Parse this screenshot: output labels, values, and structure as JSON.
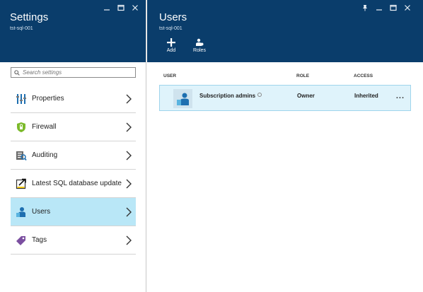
{
  "settings_blade": {
    "title": "Settings",
    "subtitle": "tst-sql-001",
    "search_placeholder": "Search settings",
    "items": [
      {
        "label": "Properties",
        "icon": "properties-icon"
      },
      {
        "label": "Firewall",
        "icon": "shield-icon"
      },
      {
        "label": "Auditing",
        "icon": "auditing-icon"
      },
      {
        "label": "Latest SQL database update",
        "icon": "update-icon"
      },
      {
        "label": "Users",
        "icon": "users-icon",
        "selected": true
      },
      {
        "label": "Tags",
        "icon": "tag-icon"
      }
    ]
  },
  "users_blade": {
    "title": "Users",
    "subtitle": "tst-sql-001",
    "commands": [
      {
        "label": "Add",
        "icon": "plus-icon"
      },
      {
        "label": "Roles",
        "icon": "roles-icon"
      }
    ],
    "columns": [
      "USER",
      "ROLE",
      "ACCESS"
    ],
    "rows": [
      {
        "user": "Subscription admins",
        "role": "Owner",
        "access": "Inherited",
        "more": "..."
      }
    ]
  },
  "colors": {
    "header_bg": "#0a3d6b",
    "selected_bg": "#b9e7f7",
    "row_bg": "#dff3fb"
  }
}
